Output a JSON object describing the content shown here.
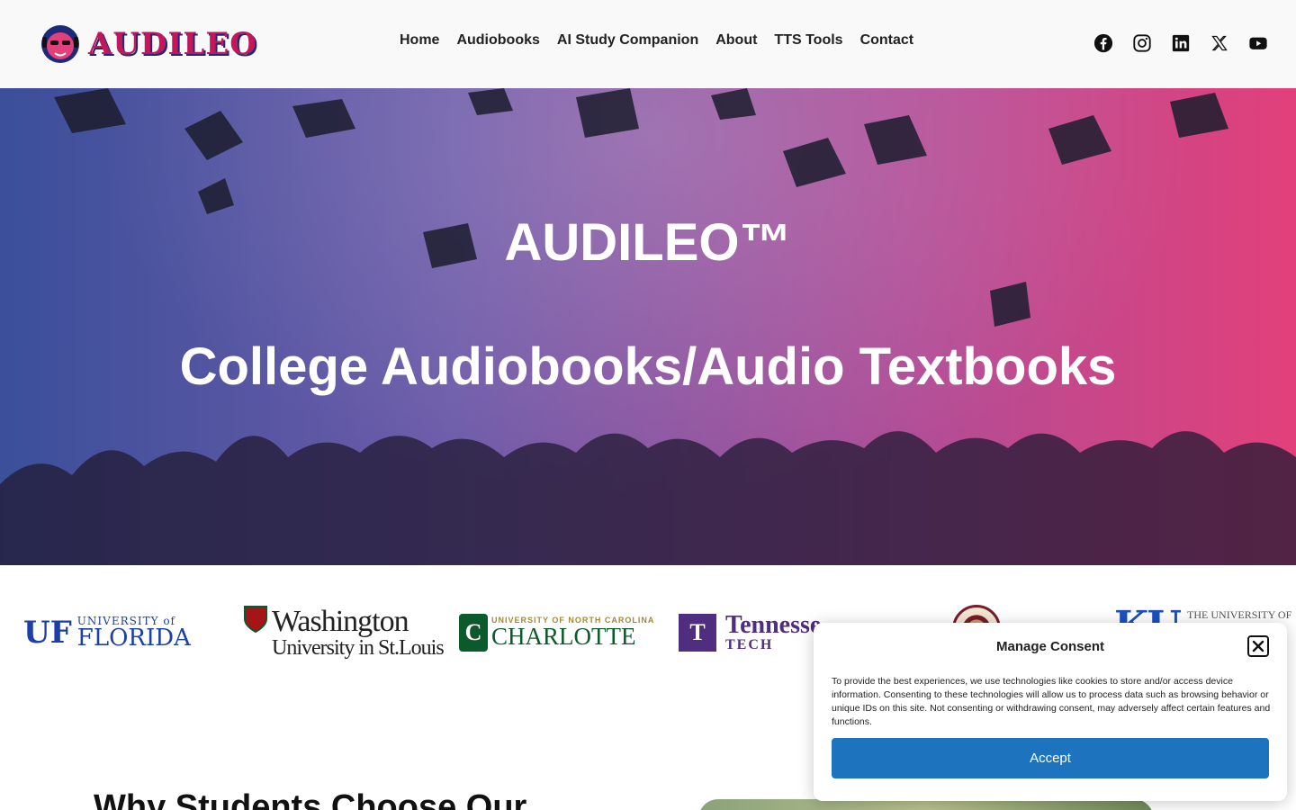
{
  "header": {
    "logo_text": "AUDILEO",
    "nav": [
      {
        "label": "Home"
      },
      {
        "label": "Audiobooks"
      },
      {
        "label": "AI Study Companion"
      },
      {
        "label": "About"
      },
      {
        "label": "TTS Tools"
      },
      {
        "label": "Contact"
      }
    ],
    "social": [
      "facebook-icon",
      "instagram-icon",
      "linkedin-icon",
      "x-icon",
      "youtube-icon"
    ]
  },
  "hero": {
    "title": "AUDILEO™",
    "subtitle": "College Audiobooks/Audio Textbooks",
    "gradient_colors": [
      "#3b4f9a",
      "#e2407a"
    ]
  },
  "universities": {
    "uf": {
      "mark": "UF",
      "small": "UNIVERSITY of",
      "large": "FLORIDA"
    },
    "washu": {
      "line1": "Washington",
      "line2": "University in St.Louis"
    },
    "charlotte": {
      "small": "UNIVERSITY OF NORTH CAROLINA",
      "large": "CHARLOTTE"
    },
    "tennessee": {
      "line1": "Tennesse",
      "line2": "TECH"
    },
    "ku": {
      "mark": "KU",
      "small": "THE UNIVERSITY OF"
    }
  },
  "section": {
    "title": "Why Students Choose Our"
  },
  "consent": {
    "title": "Manage Consent",
    "text": "To provide the best experiences, we use technologies like cookies to store and/or access device information. Consenting to these technologies will allow us to process data such as browsing behavior or unique IDs on this site. Not consenting or withdrawing consent, may adversely affect certain features and functions.",
    "accept_label": "Accept",
    "accent": "#1e73be"
  }
}
